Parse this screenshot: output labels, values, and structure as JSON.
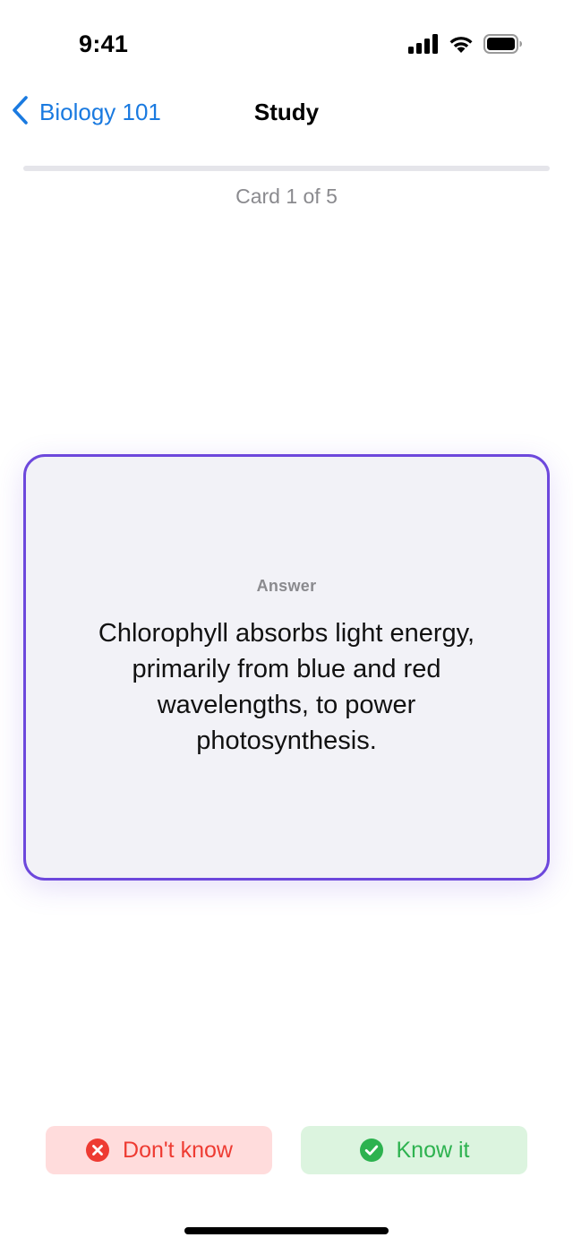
{
  "status_bar": {
    "time": "9:41",
    "icons": [
      "cellular-signal-icon",
      "wifi-icon",
      "battery-icon"
    ]
  },
  "nav": {
    "back_label": "Biology 101",
    "back_icon": "chevron-left-icon",
    "title": "Study"
  },
  "progress": {
    "counter_text": "Card 1 of 5",
    "current": 1,
    "total": 5,
    "fill_fraction": 0
  },
  "card": {
    "side_label": "Answer",
    "text": "Chlorophyll absorbs light energy, primarily from blue and red wavelengths, to power photosynthesis."
  },
  "actions": {
    "dont_know": {
      "label": "Don't know",
      "icon": "x-circle-icon"
    },
    "know_it": {
      "label": "Know it",
      "icon": "check-circle-icon"
    }
  },
  "colors": {
    "accent": "#6d48dc",
    "link": "#1a7ae0",
    "negative": "#ee3b32",
    "negative_bg": "#ffdcdc",
    "positive": "#2db24f",
    "positive_bg": "#dcf4df",
    "card_bg": "#f2f2f7"
  }
}
